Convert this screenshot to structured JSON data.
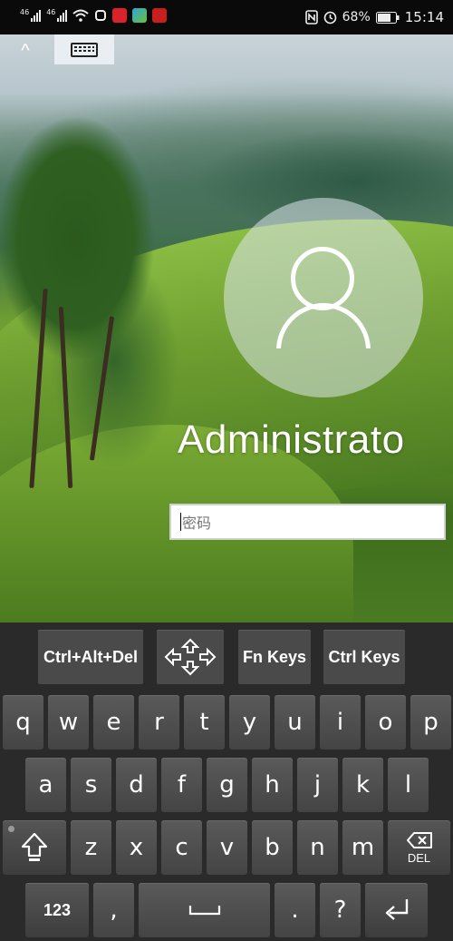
{
  "status_bar": {
    "signal1": "46",
    "signal2": "46",
    "battery": "68%",
    "time": "15:14",
    "icons": [
      "signal-icon",
      "signal-icon",
      "wifi-icon",
      "alarm-icon",
      "app-badge-red",
      "app-badge-media",
      "app-badge-news",
      "nfc-icon",
      "clock-icon",
      "battery-icon"
    ]
  },
  "remote_toolbar": {
    "collapse_glyph": "^",
    "keyboard_icon": "keyboard-icon"
  },
  "login": {
    "username": "Administrato",
    "password_placeholder": "密码"
  },
  "keyboard": {
    "function_row": [
      "Ctrl+Alt+Del",
      "",
      "Fn Keys",
      "Ctrl Keys"
    ],
    "row1": [
      "q",
      "w",
      "e",
      "r",
      "t",
      "y",
      "u",
      "i",
      "o",
      "p"
    ],
    "row2": [
      "a",
      "s",
      "d",
      "f",
      "g",
      "h",
      "j",
      "k",
      "l"
    ],
    "row3": [
      "z",
      "x",
      "c",
      "v",
      "b",
      "n",
      "m"
    ],
    "del_label": "DEL",
    "row4": {
      "num": "123",
      "comma": ",",
      "period": ".",
      "question": "?"
    }
  },
  "colors": {
    "status_bg": "#0a0a0a",
    "keyboard_bg": "#2a2a2a",
    "key_bg": "#4a4a4a",
    "toggle_bg": "#e9eef3"
  }
}
